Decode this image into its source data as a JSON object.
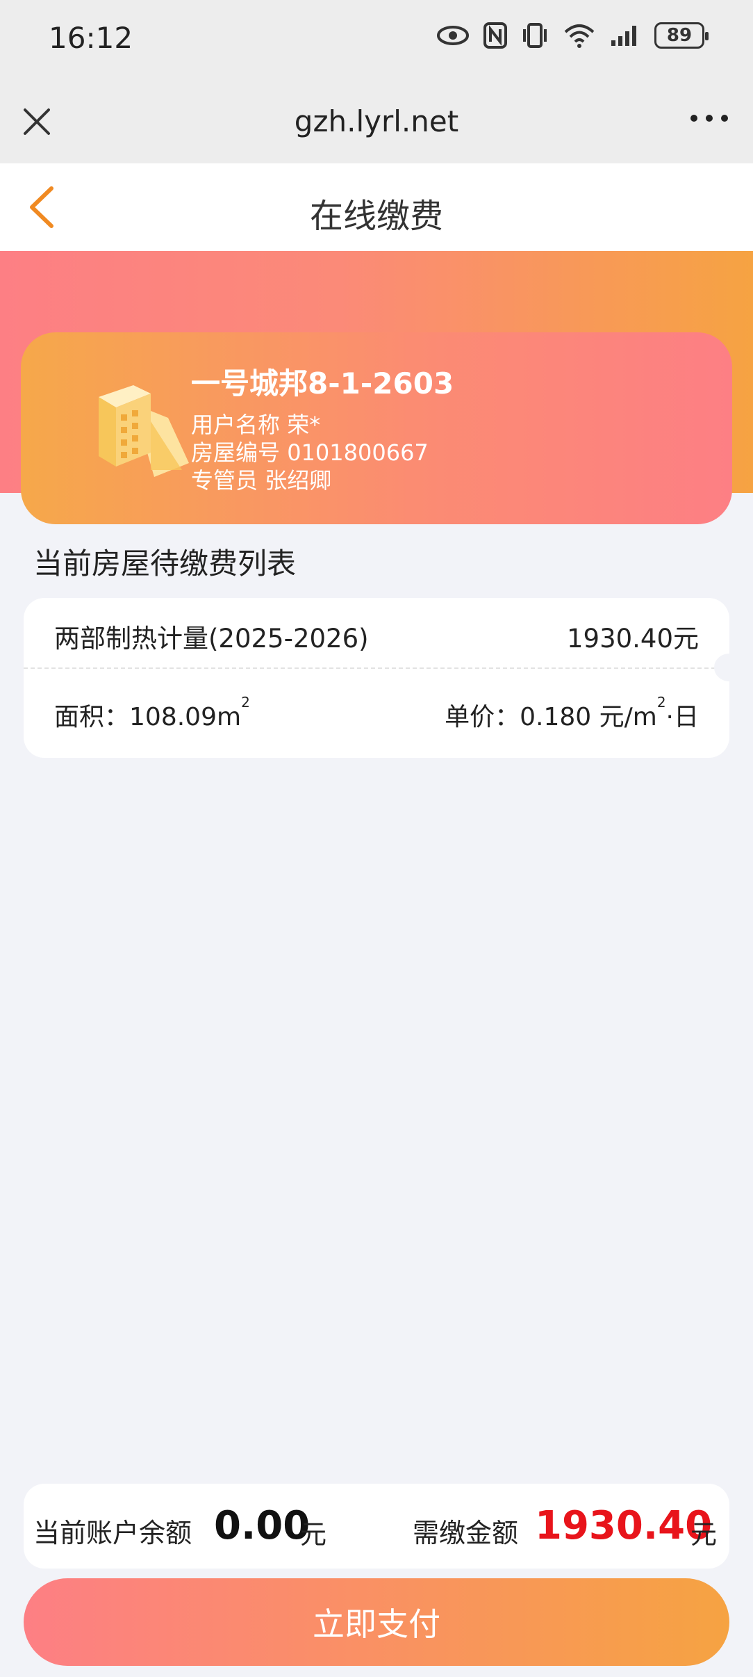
{
  "status_bar": {
    "time": "16:12",
    "battery": "89"
  },
  "browser": {
    "url": "gzh.lyrl.net"
  },
  "header": {
    "title": "在线缴费"
  },
  "house": {
    "name": "一号城邦8-1-2603",
    "user_label": "用户名称",
    "user_value": "荣*",
    "house_no_label": "房屋编号",
    "house_no_value": "0101800667",
    "manager_label": "专管员",
    "manager_value": "张绍卿"
  },
  "section_title": "当前房屋待缴费列表",
  "fees": [
    {
      "name": "两部制热计量(2025-2026)",
      "amount": "1930.40元",
      "area_label": "面积：",
      "area_value": "108.09m",
      "area_sup": "2",
      "price_label": "单价：",
      "price_value": "0.180 元/m",
      "price_sup": "2",
      "price_suffix": "·日"
    }
  ],
  "summary": {
    "balance_label": "当前账户余额",
    "balance_value": "0.00",
    "balance_unit": "元",
    "due_label": "需缴金额",
    "due_value": "1930.40",
    "due_unit": "元"
  },
  "pay_button": "立即支付",
  "colors": {
    "accent_pink": "#fd7f84",
    "accent_orange": "#f6a342",
    "due_red": "#e8141b"
  }
}
